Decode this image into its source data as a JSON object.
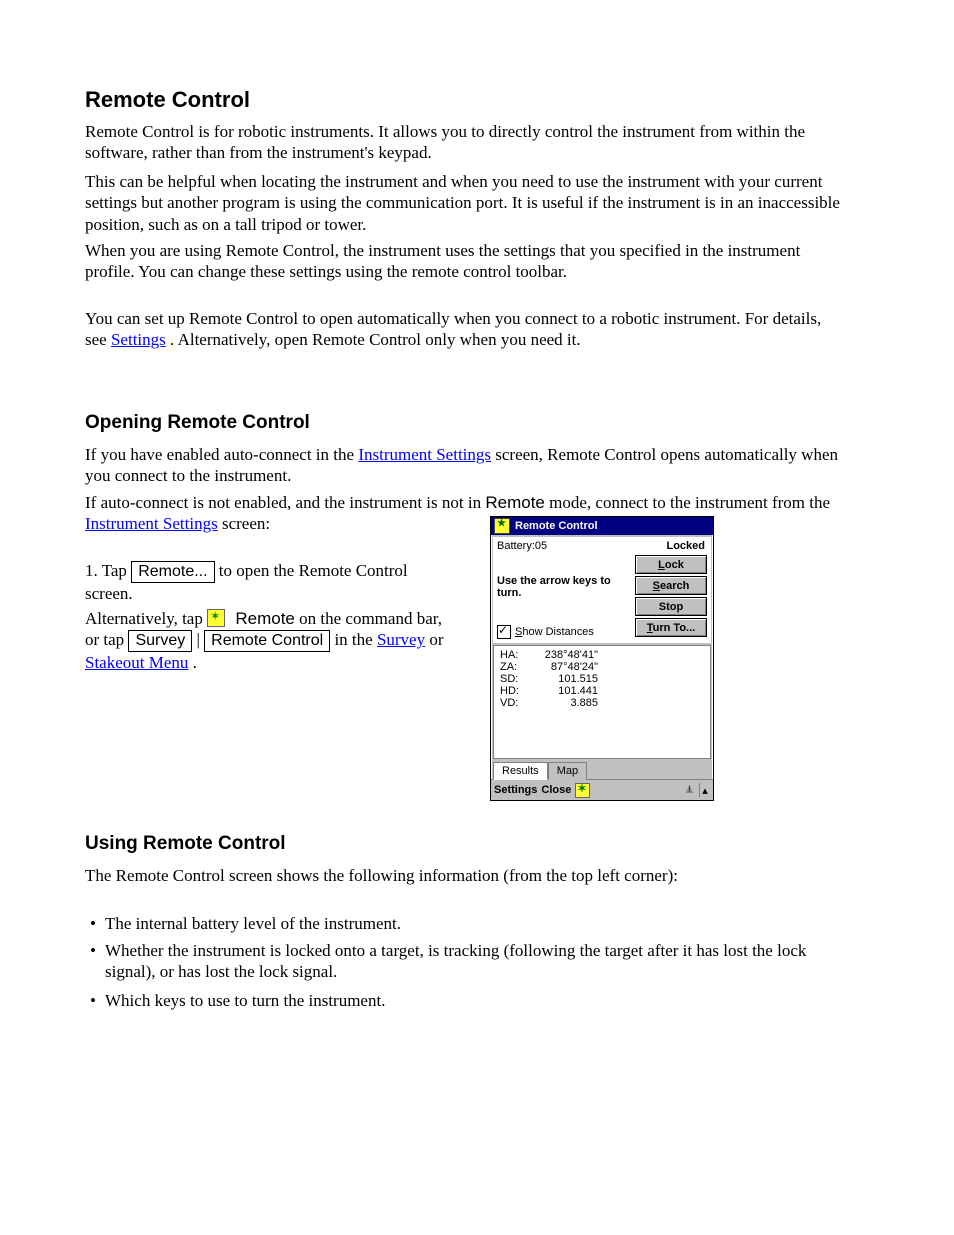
{
  "doc": {
    "h1": "Remote Control",
    "p1": "Remote Control is for robotic instruments. It allows you to directly control the instrument from within the software, rather than from the instrument's keypad.",
    "p2": "This can be helpful when locating the instrument and when you need to use the instrument with your current settings but another program is using the communication port. It is useful if the instrument is in an inaccessible position, such as on a tall tripod or tower.",
    "p3": "When you are using Remote Control, the instrument uses the settings that you specified in the instrument profile. You can change these settings using the remote control toolbar.",
    "p4a": "You can set up Remote Control to open automatically when you connect to a robotic instrument. For details, see ",
    "link_settings": "Settings",
    "p4b": ". Alternatively, open Remote Control only when you need it.",
    "h2": "Opening Remote Control",
    "p5a": "If you have enabled auto-connect in the ",
    "link_instr": "Instrument Settings",
    "p5b": " screen, Remote Control opens automatically when you connect to the instrument.",
    "p6a": "If auto-connect is not enabled, and the instrument is not in ",
    "p6a2": "Remote",
    "p6a3": " mode, connect to the instrument from the ",
    "p6b": " screen:",
    "p7a": "1.  Tap ",
    "btn_remote": "Remote...",
    "p7b": " to open the Remote Control screen.",
    "p8a": "Alternatively, tap ",
    "p8b": "Remote",
    "p8c": " on the command bar, or tap ",
    "btn_survey": "Survey",
    "p8sep": " | ",
    "btn_remote_control": "Remote Control",
    "p8d": " in the ",
    "link_survey": "Survey",
    "p8e": " or ",
    "link_stakeout": "Stakeout Menu",
    "p8f": ".",
    "h3": "Using Remote Control",
    "p9": "The Remote Control screen shows the following information (from the top left corner):",
    "b1": "The internal battery level of the instrument.",
    "b2": "Whether the instrument is locked onto a target, is tracking (following the target after it has lost the lock signal), or has lost the lock signal.",
    "b3": "Which keys to use to turn the instrument."
  },
  "dlg": {
    "title": "Remote Control",
    "battery": "Battery:05",
    "locked": "Locked",
    "hint": "Use the arrow keys to turn.",
    "show_dist_u": "S",
    "show_dist_rest": "how Distances",
    "btn_lock_u": "L",
    "btn_lock_r": "ock",
    "btn_search_u": "S",
    "btn_search_r": "earch",
    "btn_stop": "Stop",
    "btn_turn_u": "T",
    "btn_turn_r": "urn To...",
    "rows": [
      {
        "k": "HA:",
        "v": "238°48'41\""
      },
      {
        "k": "ZA:",
        "v": "87°48'24\""
      },
      {
        "k": "SD:",
        "v": "101.515"
      },
      {
        "k": "HD:",
        "v": "101.441"
      },
      {
        "k": "VD:",
        "v": "3.885"
      }
    ],
    "tabs": [
      "Results",
      "Map"
    ],
    "footer": {
      "settings": "Settings",
      "close": "Close"
    }
  }
}
